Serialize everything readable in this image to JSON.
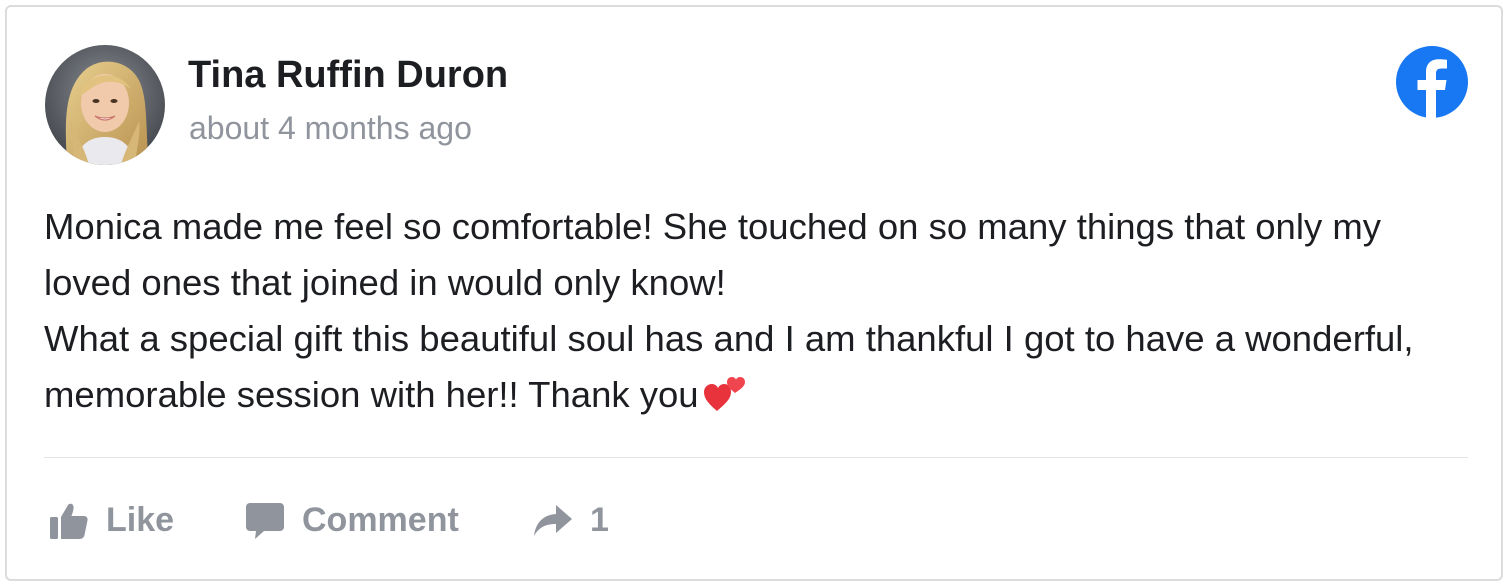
{
  "post": {
    "author": "Tina Ruffin Duron",
    "timestamp": "about 4 months ago",
    "review_lines": [
      "Monica made me feel so comfortable! She touched on so many things that only my loved ones that joined in would only know!",
      "What a special gift this beautiful soul has and I am thankful I got to have a wonderful, memorable session with her!! Thank you"
    ],
    "emoji": "two-hearts-icon"
  },
  "actions": {
    "like_label": "Like",
    "comment_label": "Comment",
    "share_count": "1"
  },
  "icons": {
    "brand": "facebook-logo-icon",
    "like": "thumbs-up-icon",
    "comment": "speech-bubble-icon",
    "share": "share-arrow-icon"
  },
  "colors": {
    "facebook_blue": "#1877f2",
    "author_text": "#1c1e21",
    "muted_text": "#90949c",
    "heart_red": "#e8323c"
  }
}
